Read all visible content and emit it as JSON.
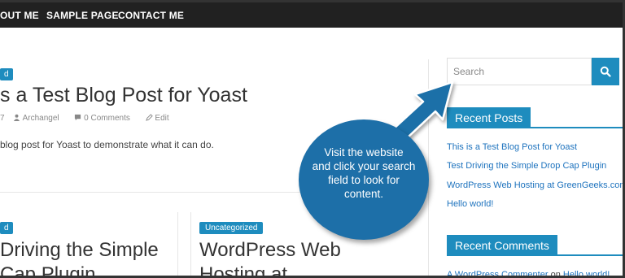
{
  "nav": {
    "items": [
      "OUT ME",
      "SAMPLE PAGE",
      "CONTACT ME"
    ]
  },
  "featured_post": {
    "category": "d",
    "title": "s a Test Blog Post for Yoast",
    "meta": {
      "date_fragment": "7",
      "author": "Archangel",
      "comments": "0 Comments",
      "edit": "Edit"
    },
    "excerpt": "blog post for Yoast to demonstrate what it can do."
  },
  "cards": [
    {
      "category": "d",
      "title_line1": "Driving the Simple",
      "title_line2": "Cap Plugin"
    },
    {
      "category": "Uncategorized",
      "title_line1": "WordPress Web",
      "title_line2": "Hosting at"
    }
  ],
  "sidebar": {
    "search": {
      "placeholder": "Search"
    },
    "recent_posts": {
      "title": "Recent Posts",
      "items": [
        "This is a Test Blog Post for Yoast",
        "Test Driving the Simple Drop Cap Plugin",
        "WordPress Web Hosting at GreenGeeks.com",
        "Hello world!"
      ]
    },
    "recent_comments": {
      "title": "Recent Comments",
      "commenter": "A WordPress Commenter",
      "on": "on",
      "post": "Hello world!"
    }
  },
  "callout": {
    "lines": [
      "Visit the website",
      "and click your search",
      "field to look for",
      "content."
    ]
  },
  "colors": {
    "accent": "#1e8cbe",
    "callout": "#1d6fa8",
    "nav_bg": "#212121"
  }
}
